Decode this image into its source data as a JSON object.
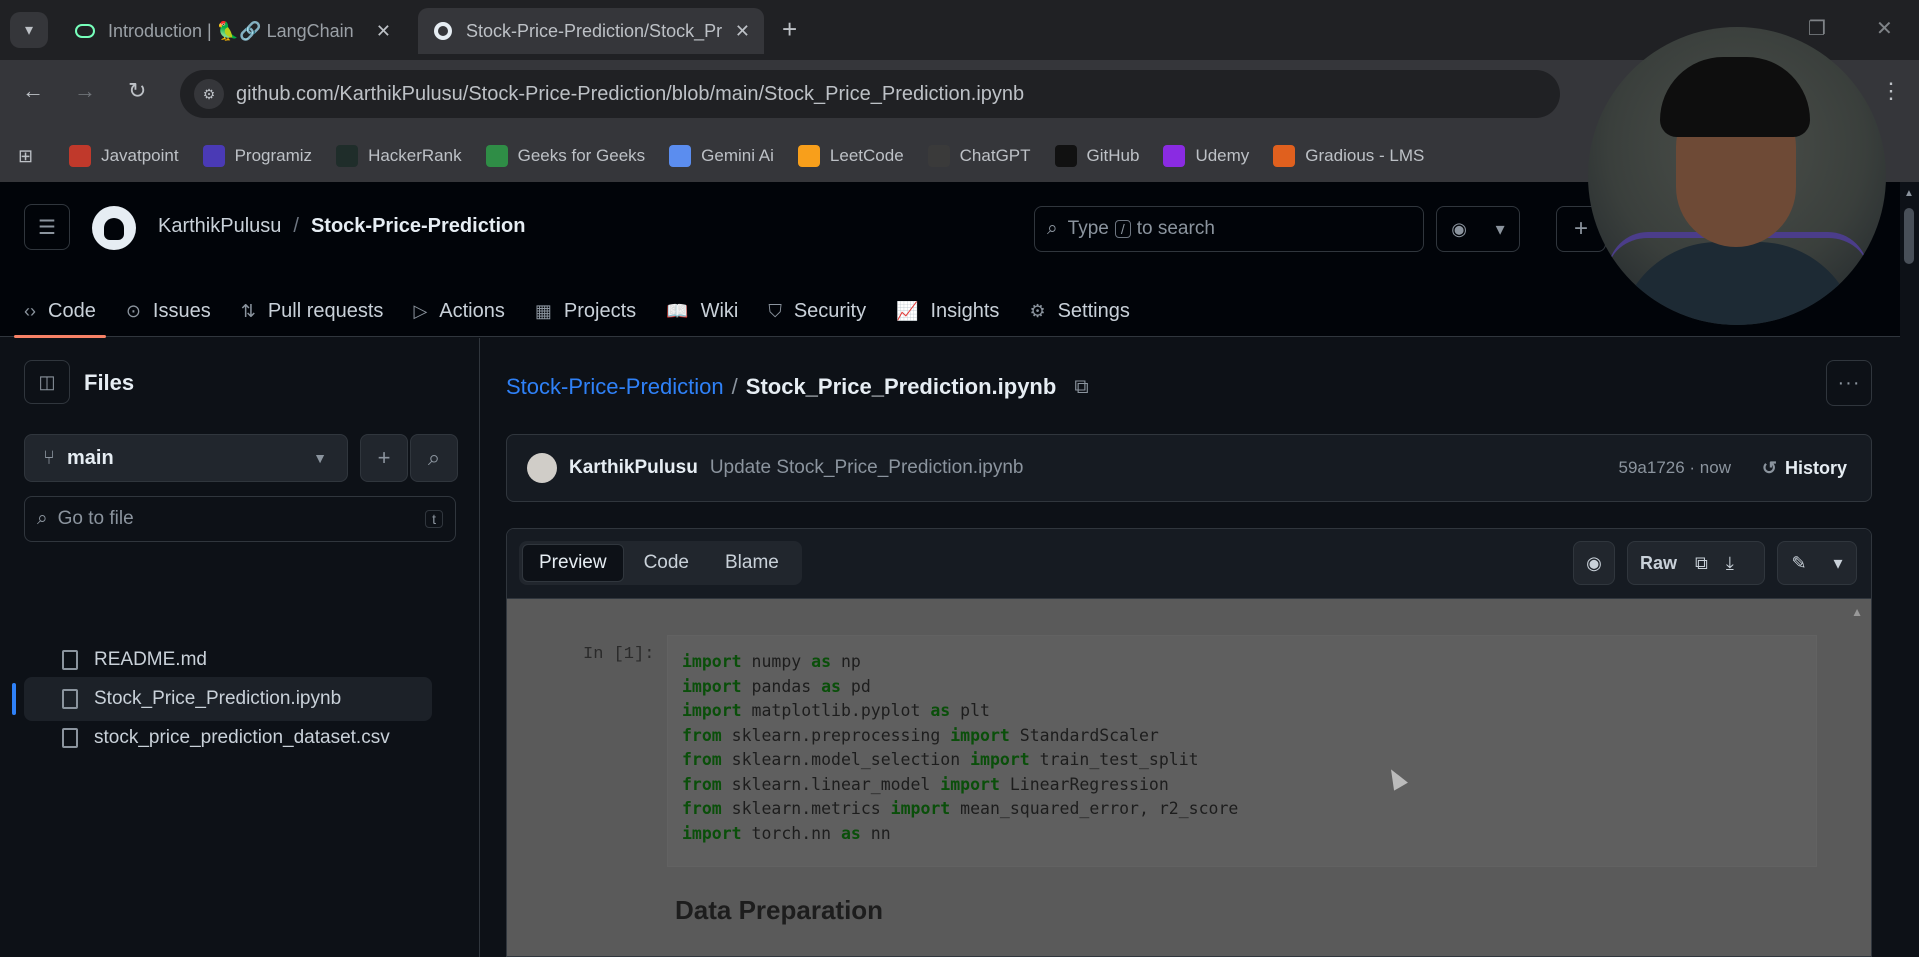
{
  "browser": {
    "tabs": [
      {
        "title": "Introduction | 🦜🔗 LangChain",
        "icon": "langchain-icon",
        "close": "✕"
      },
      {
        "title": "Stock-Price-Prediction/Stock_Pr",
        "icon": "github-icon",
        "close": "✕"
      }
    ],
    "url": "github.com/KarthikPulusu/Stock-Price-Prediction/blob/main/Stock_Price_Prediction.ipynb",
    "bookmarks": [
      {
        "label": "Javatpoint",
        "icon": "javatpoint-icon",
        "color": "#c0392b"
      },
      {
        "label": "Programiz",
        "icon": "programiz-icon",
        "color": "#4a3ab5"
      },
      {
        "label": "HackerRank",
        "icon": "hackerrank-icon",
        "color": "#1f2d2a"
      },
      {
        "label": "Geeks for Geeks",
        "icon": "gfg-icon",
        "color": "#2f8d46"
      },
      {
        "label": "Gemini Ai",
        "icon": "gemini-icon",
        "color": "#5b8def"
      },
      {
        "label": "LeetCode",
        "icon": "leetcode-icon",
        "color": "#f89f1b"
      },
      {
        "label": "ChatGPT",
        "icon": "chatgpt-icon",
        "color": "#3a3a3a"
      },
      {
        "label": "GitHub",
        "icon": "github-icon",
        "color": "#111111"
      },
      {
        "label": "Udemy",
        "icon": "udemy-icon",
        "color": "#8a2be2"
      },
      {
        "label": "Gradious - LMS",
        "icon": "gradious-icon",
        "color": "#e0601e"
      }
    ]
  },
  "header": {
    "owner": "KarthikPulusu",
    "separator": "/",
    "repo": "Stock-Price-Prediction",
    "search_prefix": "Type",
    "search_key": "/",
    "search_suffix": "to search"
  },
  "repo_nav": [
    {
      "label": "Code",
      "icon": "code-icon",
      "glyph": "‹›",
      "active": true
    },
    {
      "label": "Issues",
      "icon": "issues-icon",
      "glyph": "⊙"
    },
    {
      "label": "Pull requests",
      "icon": "pull-request-icon",
      "glyph": "⇅"
    },
    {
      "label": "Actions",
      "icon": "actions-icon",
      "glyph": "▷"
    },
    {
      "label": "Projects",
      "icon": "projects-icon",
      "glyph": "▦"
    },
    {
      "label": "Wiki",
      "icon": "wiki-icon",
      "glyph": "📖"
    },
    {
      "label": "Security",
      "icon": "shield-icon",
      "glyph": "⛉"
    },
    {
      "label": "Insights",
      "icon": "graph-icon",
      "glyph": "📈"
    },
    {
      "label": "Settings",
      "icon": "gear-icon",
      "glyph": "⚙"
    }
  ],
  "sidebar": {
    "title": "Files",
    "branch": "main",
    "goto_placeholder": "Go to file",
    "goto_key": "t",
    "files": [
      {
        "name": "README.md",
        "selected": false
      },
      {
        "name": "Stock_Price_Prediction.ipynb",
        "selected": true
      },
      {
        "name": "stock_price_prediction_dataset.csv",
        "selected": false
      }
    ]
  },
  "main": {
    "crumb_repo": "Stock-Price-Prediction",
    "crumb_sep": "/",
    "crumb_file": "Stock_Price_Prediction.ipynb",
    "commit": {
      "author": "KarthikPulusu",
      "message": "Update Stock_Price_Prediction.ipynb",
      "sha": "59a1726 · now",
      "history": "History"
    },
    "view_tabs": [
      "Preview",
      "Code",
      "Blame"
    ],
    "raw_label": "Raw",
    "notebook": {
      "prompt": "In [1]:",
      "code_lines": [
        [
          {
            "k": true,
            "t": "import"
          },
          {
            "k": false,
            "t": " numpy "
          },
          {
            "k": true,
            "t": "as"
          },
          {
            "k": false,
            "t": " np"
          }
        ],
        [
          {
            "k": true,
            "t": "import"
          },
          {
            "k": false,
            "t": " pandas "
          },
          {
            "k": true,
            "t": "as"
          },
          {
            "k": false,
            "t": " pd"
          }
        ],
        [
          {
            "k": true,
            "t": "import"
          },
          {
            "k": false,
            "t": " matplotlib.pyplot "
          },
          {
            "k": true,
            "t": "as"
          },
          {
            "k": false,
            "t": " plt"
          }
        ],
        [
          {
            "k": true,
            "t": "from"
          },
          {
            "k": false,
            "t": " sklearn.preprocessing "
          },
          {
            "k": true,
            "t": "import"
          },
          {
            "k": false,
            "t": " StandardScaler"
          }
        ],
        [
          {
            "k": true,
            "t": "from"
          },
          {
            "k": false,
            "t": " sklearn.model_selection "
          },
          {
            "k": true,
            "t": "import"
          },
          {
            "k": false,
            "t": " train_test_split"
          }
        ],
        [
          {
            "k": true,
            "t": "from"
          },
          {
            "k": false,
            "t": " sklearn.linear_model "
          },
          {
            "k": true,
            "t": "import"
          },
          {
            "k": false,
            "t": " LinearRegression"
          }
        ],
        [
          {
            "k": true,
            "t": "from"
          },
          {
            "k": false,
            "t": " sklearn.metrics "
          },
          {
            "k": true,
            "t": "import"
          },
          {
            "k": false,
            "t": " mean_squared_error, r2_score"
          }
        ],
        [
          {
            "k": true,
            "t": "import"
          },
          {
            "k": false,
            "t": " torch.nn "
          },
          {
            "k": true,
            "t": "as"
          },
          {
            "k": false,
            "t": " nn"
          }
        ]
      ],
      "heading": "Data Preparation"
    }
  }
}
